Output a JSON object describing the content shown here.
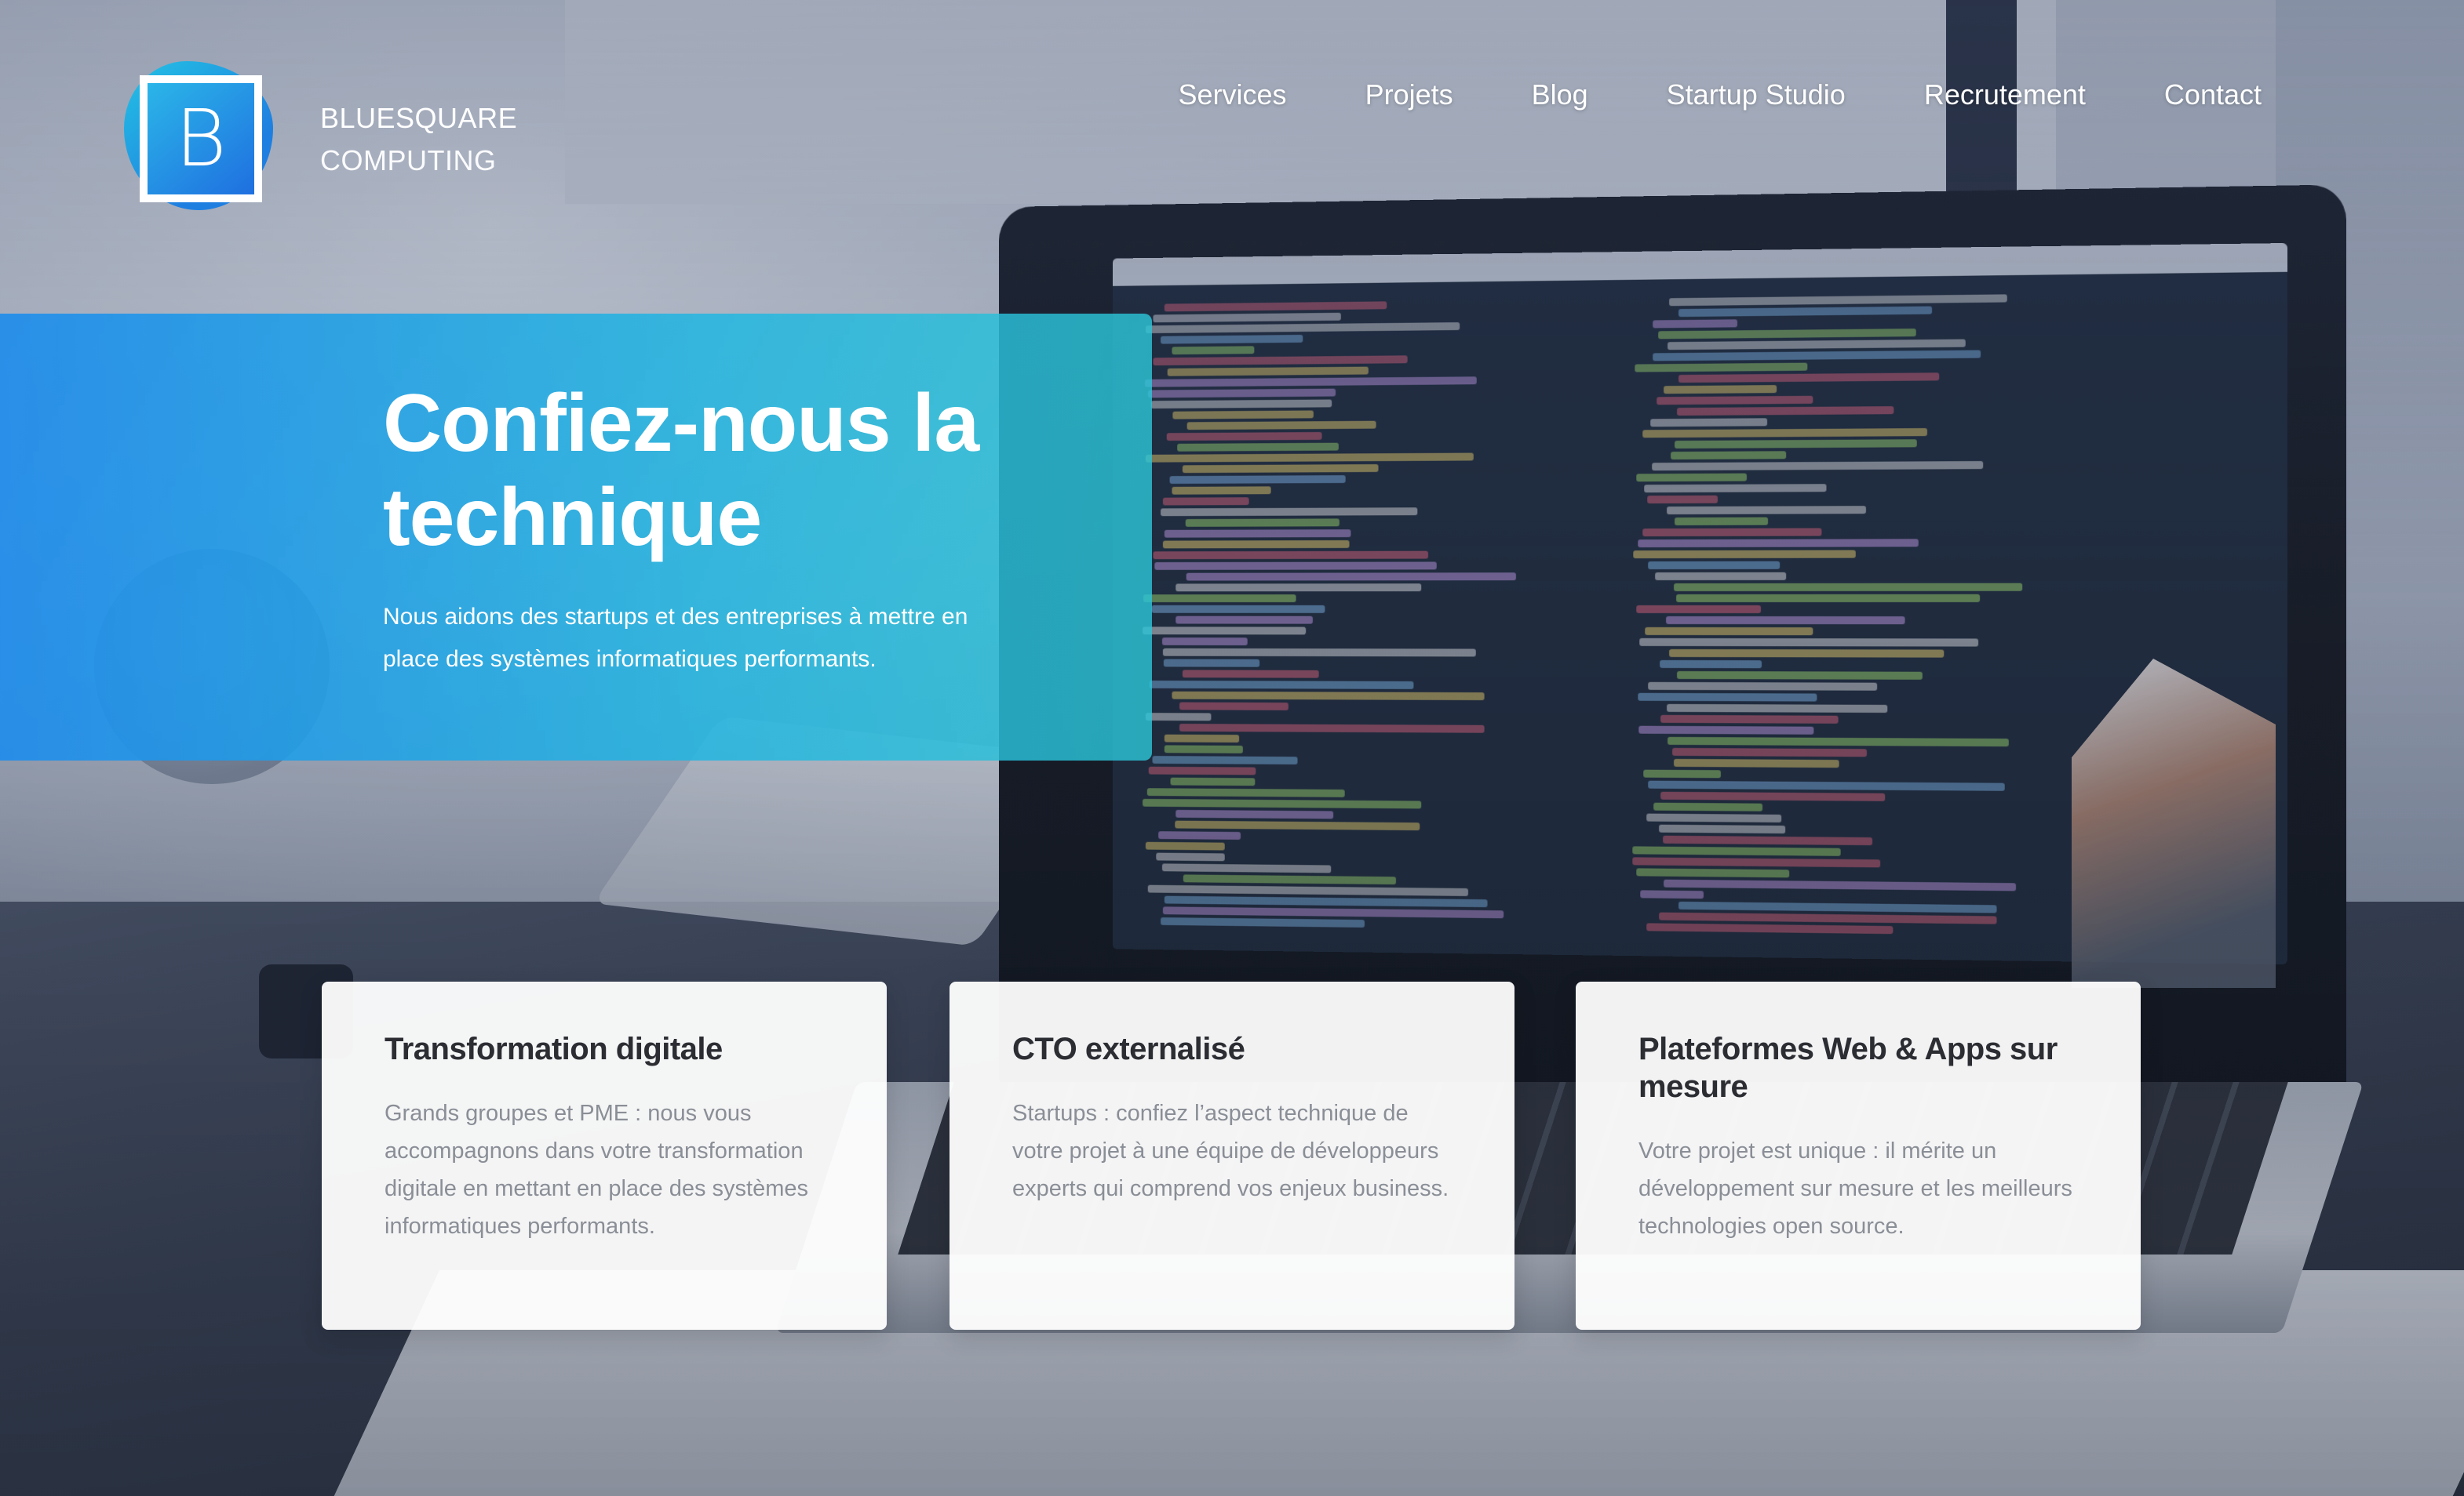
{
  "logo": {
    "letter": "B",
    "line1": "BLUESQUARE",
    "line2": "COMPUTING"
  },
  "nav": {
    "items": [
      {
        "label": "Services"
      },
      {
        "label": "Projets"
      },
      {
        "label": "Blog"
      },
      {
        "label": "Startup Studio"
      },
      {
        "label": "Recrutement"
      },
      {
        "label": "Contact"
      }
    ]
  },
  "hero": {
    "title": "Confiez-nous la technique",
    "subtitle": "Nous aidons des startups et des entreprises à mettre en place des systèmes informatiques performants."
  },
  "cards": [
    {
      "title": "Transformation digitale",
      "text": "Grands groupes et PME : nous vous accompagnons dans votre transformation digitale en mettant en place des systèmes informatiques performants."
    },
    {
      "title": "CTO externalisé",
      "text": "Startups : confiez l’aspect technique de votre projet à une équipe de développeurs experts qui comprend vos enjeux business."
    },
    {
      "title": "Plateformes Web & Apps sur mesure",
      "text": "Votre projet est unique : il mérite un développement sur mesure et les meilleurs technologies open source."
    }
  ],
  "colors": {
    "hero_start": "#1f8ceb",
    "hero_end": "#2cc4d6",
    "logo_blue": "#1f6fe0",
    "card_title": "#2b2d33",
    "card_text": "#8a8e96"
  }
}
